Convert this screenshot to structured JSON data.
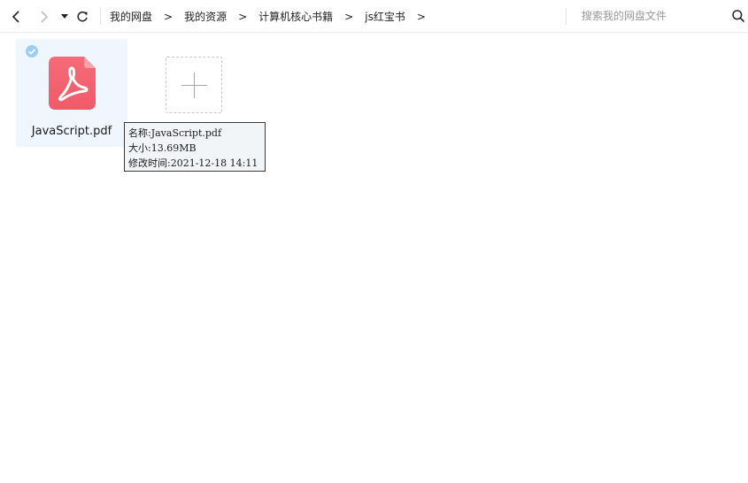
{
  "toolbar": {
    "breadcrumbs": [
      "我的网盘",
      "我的资源",
      "计算机核心书籍",
      "js红宝书"
    ],
    "crumb_separator": ">",
    "search_placeholder": "搜索我的网盘文件"
  },
  "files": [
    {
      "name": "JavaScript.pdf",
      "icon": "pdf-file-icon",
      "selected": true
    }
  ],
  "tooltip": {
    "line_name": "名称:JavaScript.pdf",
    "line_size": "大小:13.69MB",
    "line_modified": "修改时间:2021-12-18 14:11"
  },
  "colors": {
    "accent": "#4da3f5",
    "pdf_icon": "#f2606e",
    "selected_bg": "#f0f6fd"
  }
}
